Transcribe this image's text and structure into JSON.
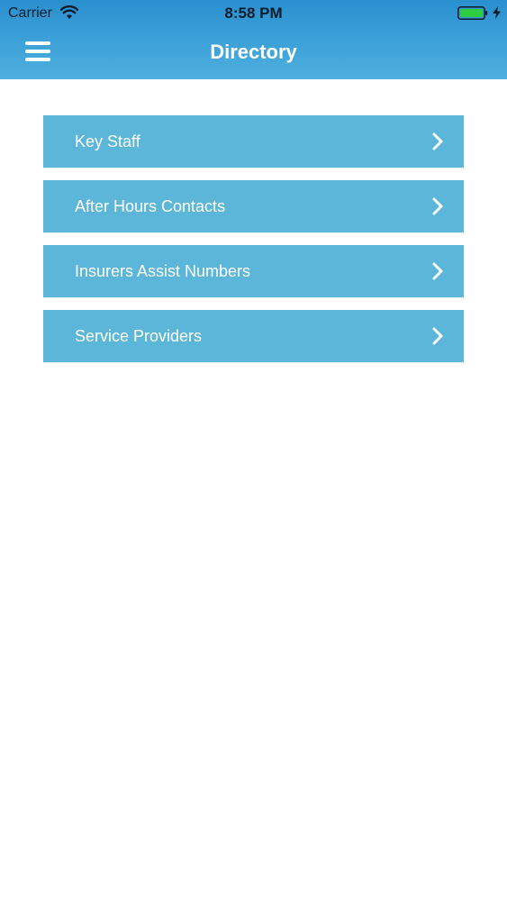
{
  "status_bar": {
    "carrier": "Carrier",
    "time": "8:58 PM",
    "wifi_icon": "wifi-icon",
    "battery_icon": "battery-full-icon",
    "charging_icon": "charging-bolt-icon",
    "battery_color": "#2ecc40"
  },
  "header": {
    "title": "Directory",
    "menu_icon": "hamburger-menu-icon",
    "gradient_top": "#2a8fcf",
    "gradient_bottom": "#4fb0de"
  },
  "directory": {
    "item_color": "#5bb6d9",
    "chevron_icon": "chevron-right-icon",
    "items": [
      {
        "label": "Key Staff"
      },
      {
        "label": "After Hours Contacts"
      },
      {
        "label": "Insurers Assist Numbers"
      },
      {
        "label": "Service Providers"
      }
    ]
  }
}
